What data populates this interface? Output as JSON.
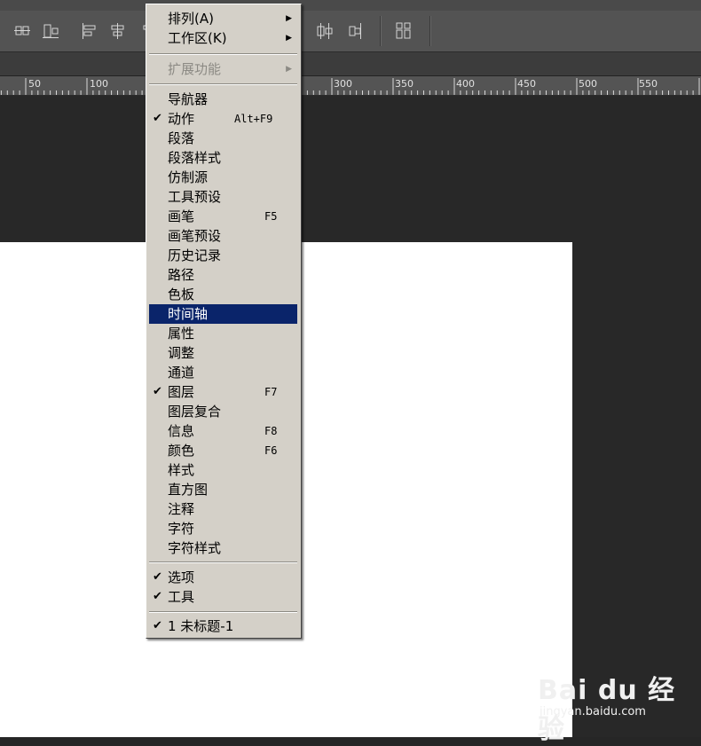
{
  "ruler": {
    "labels": [
      "50",
      "100",
      "300",
      "350",
      "400",
      "450",
      "500",
      "550"
    ]
  },
  "menu": {
    "items": [
      {
        "label": "排列(A)",
        "submenu": true
      },
      {
        "label": "工作区(K)",
        "submenu": true
      },
      {
        "label": "扩展功能",
        "submenu": true,
        "disabled": true
      },
      {
        "label": "导航器"
      },
      {
        "label": "动作",
        "checked": true,
        "shortcut": "Alt+F9"
      },
      {
        "label": "段落"
      },
      {
        "label": "段落样式"
      },
      {
        "label": "仿制源"
      },
      {
        "label": "工具预设"
      },
      {
        "label": "画笔",
        "shortcut": "F5"
      },
      {
        "label": "画笔预设"
      },
      {
        "label": "历史记录"
      },
      {
        "label": "路径"
      },
      {
        "label": "色板"
      },
      {
        "label": "时间轴",
        "highlighted": true
      },
      {
        "label": "属性"
      },
      {
        "label": "调整"
      },
      {
        "label": "通道"
      },
      {
        "label": "图层",
        "checked": true,
        "shortcut": "F7"
      },
      {
        "label": "图层复合"
      },
      {
        "label": "信息",
        "shortcut": "F8"
      },
      {
        "label": "颜色",
        "shortcut": "F6"
      },
      {
        "label": "样式"
      },
      {
        "label": "直方图"
      },
      {
        "label": "注释"
      },
      {
        "label": "字符"
      },
      {
        "label": "字符样式"
      },
      {
        "label": "选项",
        "checked": true
      },
      {
        "label": "工具",
        "checked": true
      },
      {
        "label": "1 未标题-1",
        "checked": true
      }
    ],
    "check_glyph": "✔",
    "arrow_glyph": "▶",
    "highlight_color": "#0a246a"
  },
  "watermark": {
    "brand": "Bai du 经验",
    "url": "jingyan.baidu.com"
  }
}
